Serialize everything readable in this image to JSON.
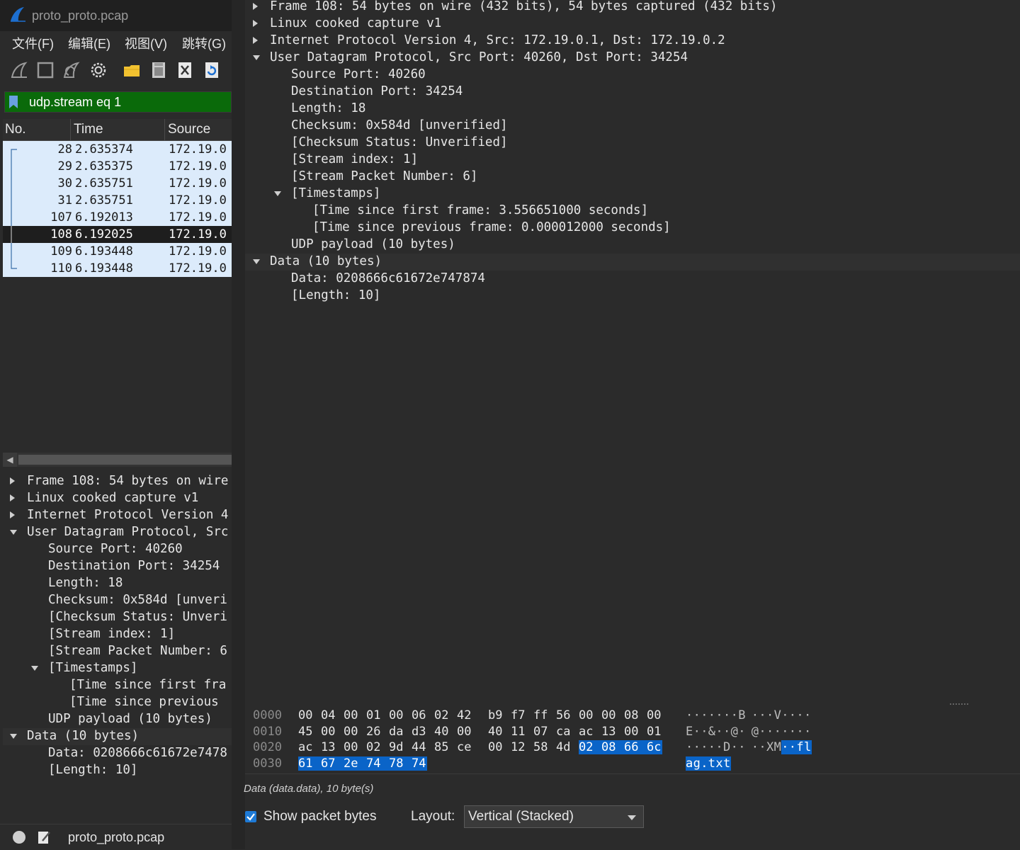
{
  "window": {
    "title": "proto_proto.pcap"
  },
  "menu": {
    "items": [
      "文件(F)",
      "编辑(E)",
      "视图(V)",
      "跳转(G)"
    ]
  },
  "toolbar": {
    "icons": [
      "shark-fin-start-icon",
      "stop-square-icon",
      "restart-fin-icon",
      "options-gear-icon",
      "open-folder-icon",
      "save-file-icon",
      "close-file-icon",
      "reload-icon"
    ]
  },
  "filter": {
    "value": "udp.stream eq 1",
    "bg_color": "#0a6a0a"
  },
  "packet_list": {
    "columns": [
      "No.",
      "Time",
      "Source"
    ],
    "rows": [
      {
        "no": "28",
        "time": "2.635374",
        "source": "172.19.0",
        "selected": false
      },
      {
        "no": "29",
        "time": "2.635375",
        "source": "172.19.0",
        "selected": false
      },
      {
        "no": "30",
        "time": "2.635751",
        "source": "172.19.0",
        "selected": false
      },
      {
        "no": "31",
        "time": "2.635751",
        "source": "172.19.0",
        "selected": false
      },
      {
        "no": "107",
        "time": "6.192013",
        "source": "172.19.0",
        "selected": false
      },
      {
        "no": "108",
        "time": "6.192025",
        "source": "172.19.0",
        "selected": true
      },
      {
        "no": "109",
        "time": "6.193448",
        "source": "172.19.0",
        "selected": false
      },
      {
        "no": "110",
        "time": "6.193448",
        "source": "172.19.0",
        "selected": false
      }
    ]
  },
  "left_detail": {
    "lines": [
      {
        "text": "Frame 108: 54 bytes on wire",
        "level": 0,
        "arrow": "right"
      },
      {
        "text": "Linux cooked capture v1",
        "level": 0,
        "arrow": "right"
      },
      {
        "text": "Internet Protocol Version 4",
        "level": 0,
        "arrow": "right"
      },
      {
        "text": "User Datagram Protocol, Src",
        "level": 0,
        "arrow": "down"
      },
      {
        "text": "Source Port: 40260",
        "level": 1,
        "arrow": ""
      },
      {
        "text": "Destination Port: 34254",
        "level": 1,
        "arrow": ""
      },
      {
        "text": "Length: 18",
        "level": 1,
        "arrow": ""
      },
      {
        "text": "Checksum: 0x584d [unveri",
        "level": 1,
        "arrow": ""
      },
      {
        "text": "[Checksum Status: Unveri",
        "level": 1,
        "arrow": ""
      },
      {
        "text": "[Stream index: 1]",
        "level": 1,
        "arrow": ""
      },
      {
        "text": "[Stream Packet Number: 6",
        "level": 1,
        "arrow": ""
      },
      {
        "text": "[Timestamps]",
        "level": 1,
        "arrow": "down"
      },
      {
        "text": "[Time since first fra",
        "level": 2,
        "arrow": ""
      },
      {
        "text": "[Time since previous",
        "level": 2,
        "arrow": ""
      },
      {
        "text": "UDP payload (10 bytes)",
        "level": 1,
        "arrow": ""
      },
      {
        "text": "Data (10 bytes)",
        "level": 0,
        "arrow": "down",
        "selected": true
      },
      {
        "text": "Data: 0208666c61672e7478",
        "level": 1,
        "arrow": ""
      },
      {
        "text": "[Length: 10]",
        "level": 1,
        "arrow": ""
      }
    ]
  },
  "right_detail": {
    "lines": [
      {
        "text": "Frame 108: 54 bytes on wire (432 bits), 54 bytes captured (432 bits)",
        "level": 0,
        "arrow": "right"
      },
      {
        "text": "Linux cooked capture v1",
        "level": 0,
        "arrow": "right"
      },
      {
        "text": "Internet Protocol Version 4, Src: 172.19.0.1, Dst: 172.19.0.2",
        "level": 0,
        "arrow": "right"
      },
      {
        "text": "User Datagram Protocol, Src Port: 40260, Dst Port: 34254",
        "level": 0,
        "arrow": "down"
      },
      {
        "text": "Source Port: 40260",
        "level": 1,
        "arrow": ""
      },
      {
        "text": "Destination Port: 34254",
        "level": 1,
        "arrow": ""
      },
      {
        "text": "Length: 18",
        "level": 1,
        "arrow": ""
      },
      {
        "text": "Checksum: 0x584d [unverified]",
        "level": 1,
        "arrow": ""
      },
      {
        "text": "[Checksum Status: Unverified]",
        "level": 1,
        "arrow": ""
      },
      {
        "text": "[Stream index: 1]",
        "level": 1,
        "arrow": ""
      },
      {
        "text": "[Stream Packet Number: 6]",
        "level": 1,
        "arrow": ""
      },
      {
        "text": "[Timestamps]",
        "level": 1,
        "arrow": "down"
      },
      {
        "text": "[Time since first frame: 3.556651000 seconds]",
        "level": 2,
        "arrow": ""
      },
      {
        "text": "[Time since previous frame: 0.000012000 seconds]",
        "level": 2,
        "arrow": ""
      },
      {
        "text": "UDP payload (10 bytes)",
        "level": 1,
        "arrow": ""
      },
      {
        "text": "Data (10 bytes)",
        "level": 0,
        "arrow": "down",
        "selected": true
      },
      {
        "text": "Data: 0208666c61672e747874",
        "level": 1,
        "arrow": ""
      },
      {
        "text": "[Length: 10]",
        "level": 1,
        "arrow": ""
      }
    ]
  },
  "hex_dump": {
    "rows": [
      {
        "offset": "0000",
        "bytes": [
          "00",
          "04",
          "00",
          "01",
          "00",
          "06",
          "02",
          "42",
          "b9",
          "f7",
          "ff",
          "56",
          "00",
          "00",
          "08",
          "00"
        ],
        "hl": [],
        "ascii": [
          "·",
          "·",
          "·",
          "·",
          "·",
          "·",
          "·",
          "B",
          "·",
          "·",
          "·",
          "V",
          "·",
          "·",
          "·",
          "·"
        ],
        "ascii_hl": []
      },
      {
        "offset": "0010",
        "bytes": [
          "45",
          "00",
          "00",
          "26",
          "da",
          "d3",
          "40",
          "00",
          "40",
          "11",
          "07",
          "ca",
          "ac",
          "13",
          "00",
          "01"
        ],
        "hl": [],
        "ascii": [
          "E",
          "·",
          "·",
          "&",
          "·",
          "·",
          "@",
          "·",
          "@",
          "·",
          "·",
          "·",
          "·",
          "·",
          "·",
          "·"
        ],
        "ascii_hl": []
      },
      {
        "offset": "0020",
        "bytes": [
          "ac",
          "13",
          "00",
          "02",
          "9d",
          "44",
          "85",
          "ce",
          "00",
          "12",
          "58",
          "4d",
          "02",
          "08",
          "66",
          "6c"
        ],
        "hl": [
          12,
          13,
          14,
          15
        ],
        "ascii": [
          "·",
          "·",
          "·",
          "·",
          "·",
          "D",
          "·",
          "·",
          "·",
          "·",
          "X",
          "M",
          "·",
          "·",
          "f",
          "l"
        ],
        "ascii_hl": [
          12,
          13,
          14,
          15
        ]
      },
      {
        "offset": "0030",
        "bytes": [
          "61",
          "67",
          "2e",
          "74",
          "78",
          "74"
        ],
        "hl": [
          0,
          1,
          2,
          3,
          4,
          5
        ],
        "ascii": [
          "a",
          "g",
          ".",
          "t",
          "x",
          "t"
        ],
        "ascii_hl": [
          0,
          1,
          2,
          3,
          4,
          5
        ]
      }
    ],
    "highlight_color": "#0a64c8"
  },
  "bytes_status": {
    "info": "Data (data.data), 10 byte(s)",
    "show_bytes_label": "Show packet bytes",
    "show_bytes_checked": true,
    "layout_label": "Layout:",
    "layout_value": "Vertical (Stacked)"
  },
  "statusbar": {
    "file": "proto_proto.pcap"
  }
}
